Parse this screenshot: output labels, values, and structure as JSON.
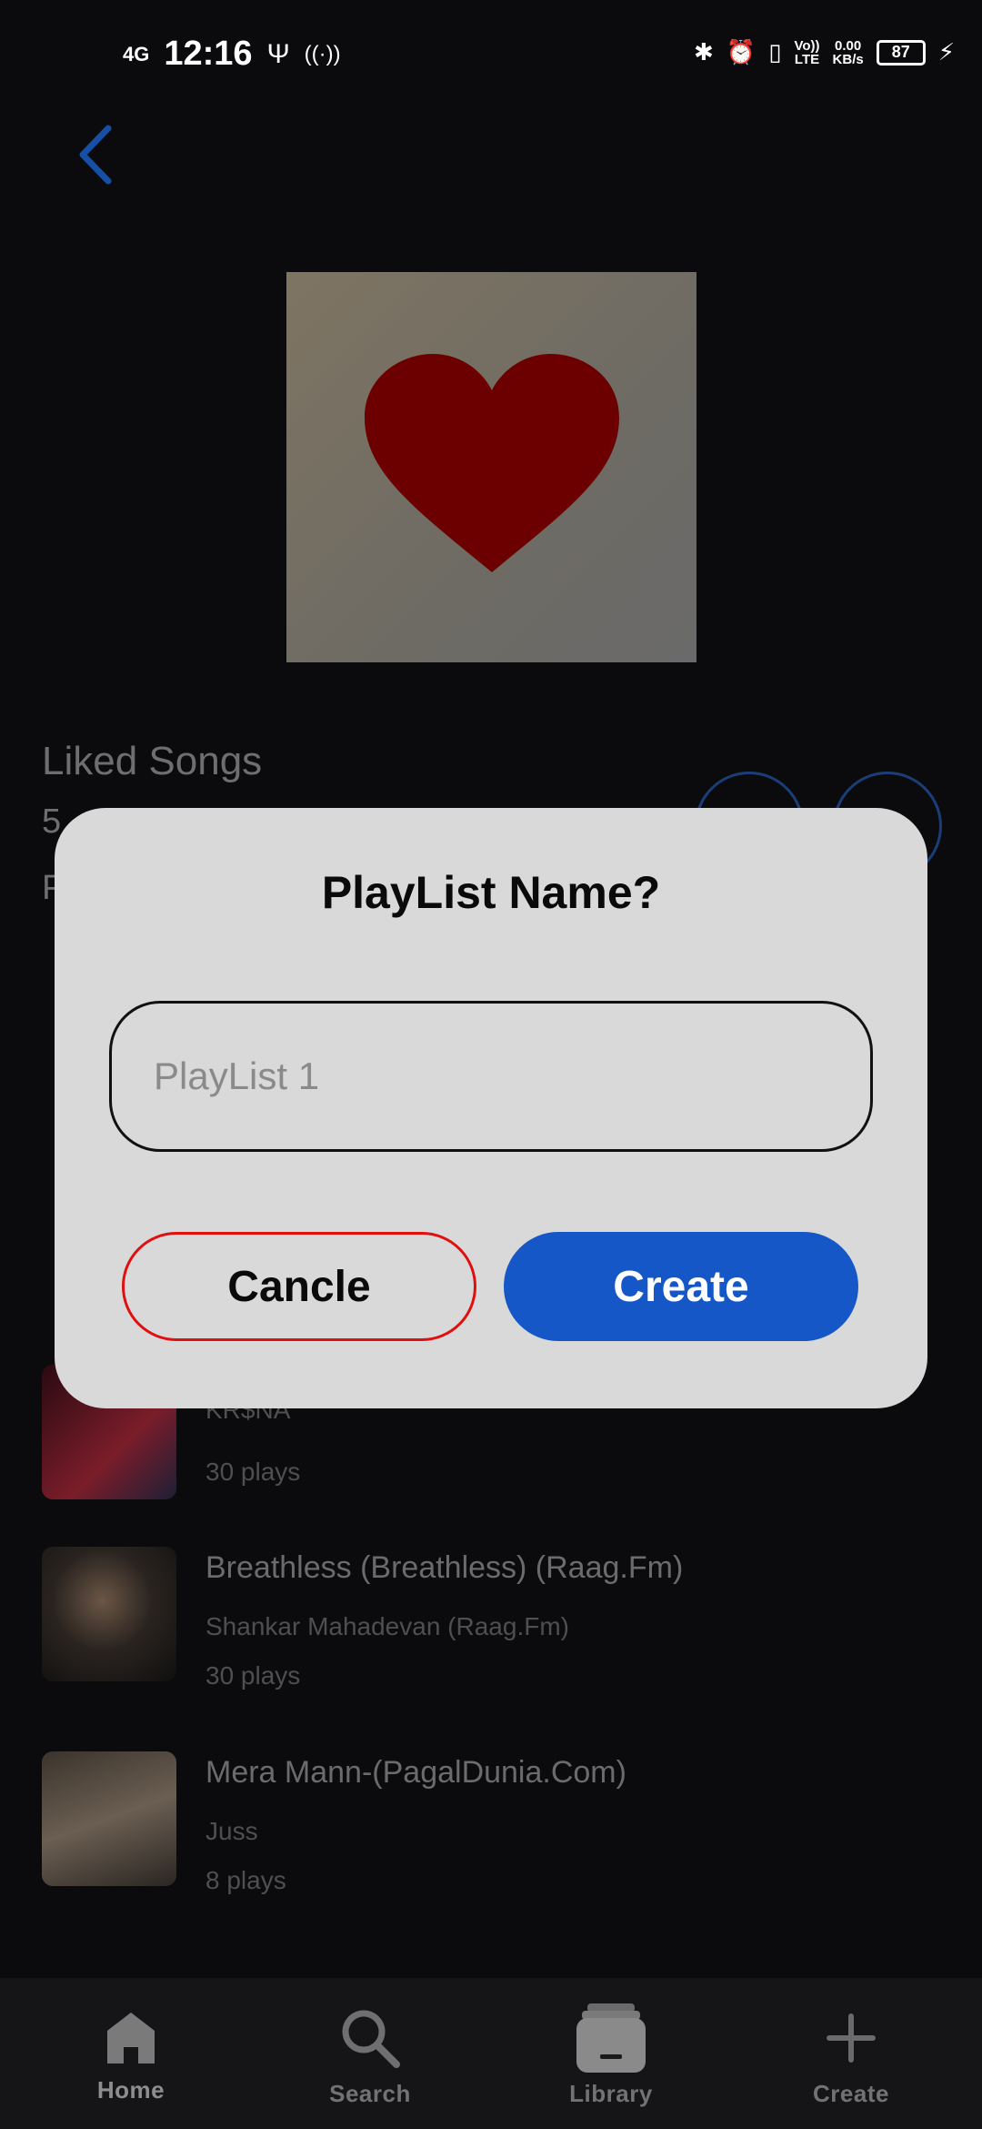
{
  "status_bar": {
    "network": "4G",
    "time": "12:16",
    "data_speed_top": "0.00",
    "data_speed_bottom": "KB/s",
    "volte_top": "Vo))",
    "volte_bottom": "LTE",
    "battery": "87"
  },
  "playlist": {
    "title": "Liked Songs",
    "sub1": "5",
    "sub2": "P"
  },
  "songs": [
    {
      "title": "",
      "artist": "KR$NA",
      "plays": "30 plays",
      "thumb_colors": [
        "#3a0a0e",
        "#7a1d2a"
      ]
    },
    {
      "title": "Breathless (Breathless) (Raag.Fm)",
      "artist": "Shankar Mahadevan (Raag.Fm)",
      "plays": "30 plays",
      "thumb_colors": [
        "#1a1a1a",
        "#5b4a3a"
      ]
    },
    {
      "title": "Mera Mann-(PagalDunia.Com)",
      "artist": "Juss",
      "plays": "8 plays",
      "thumb_colors": [
        "#2b2824",
        "#6b5e52"
      ]
    }
  ],
  "dialog": {
    "title": "PlayList Name?",
    "input_placeholder": "PlayList 1",
    "input_value": "",
    "cancel_label": "Cancle",
    "create_label": "Create"
  },
  "nav": {
    "home": "Home",
    "search": "Search",
    "library": "Library",
    "create": "Create"
  },
  "colors": {
    "accent_blue": "#1557c7",
    "cancel_red": "#e01010",
    "heart": "#6c0000"
  },
  "icons": [
    "back-icon",
    "heart-icon",
    "home-icon",
    "search-icon",
    "library-icon",
    "plus-icon"
  ]
}
